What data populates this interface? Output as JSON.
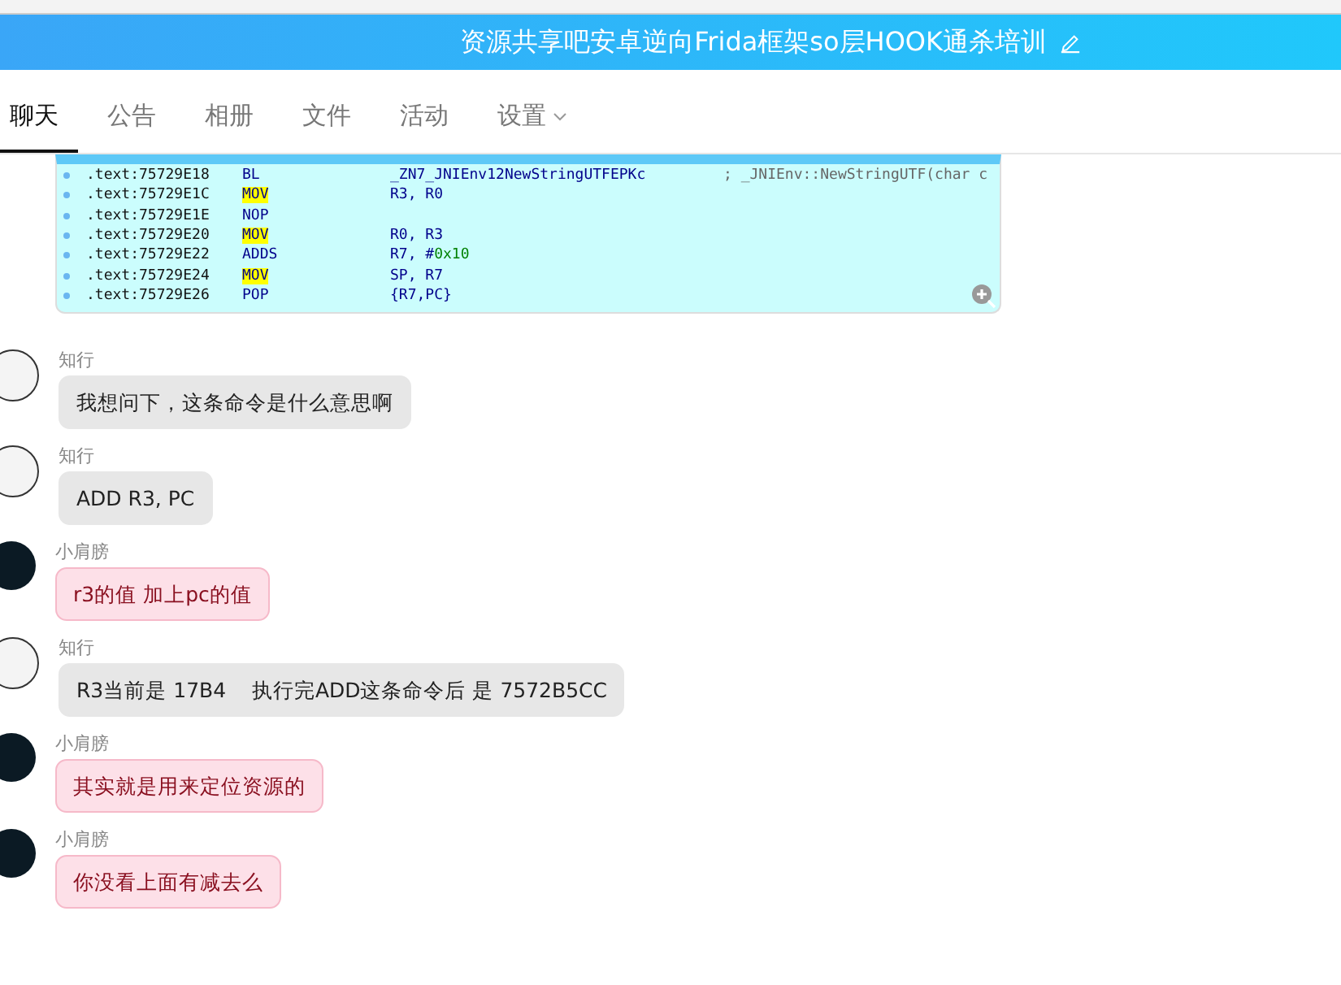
{
  "header": {
    "title": "资源共享吧安卓逆向Frida框架so层HOOK通杀培训"
  },
  "tabs": [
    {
      "label": "聊天",
      "selected": true,
      "dropdown": false
    },
    {
      "label": "公告",
      "selected": false,
      "dropdown": false
    },
    {
      "label": "相册",
      "selected": false,
      "dropdown": false
    },
    {
      "label": "文件",
      "selected": false,
      "dropdown": false
    },
    {
      "label": "活动",
      "selected": false,
      "dropdown": false
    },
    {
      "label": "设置",
      "selected": false,
      "dropdown": true
    }
  ],
  "code_image": {
    "lines": [
      {
        "address": ".text:75729E18",
        "op": "BL",
        "highlight": false,
        "args": "_ZN7_JNIEnv12NewStringUTFEPKc",
        "comment": "; _JNIEnv::NewStringUTF(char c"
      },
      {
        "address": ".text:75729E1C",
        "op": "MOV",
        "highlight": true,
        "args": "R3, R0"
      },
      {
        "address": ".text:75729E1E",
        "op": "NOP",
        "highlight": false
      },
      {
        "address": ".text:75729E20",
        "op": "MOV",
        "highlight": true,
        "args": "R0, R3"
      },
      {
        "address": ".text:75729E22",
        "op": "ADDS",
        "highlight": false,
        "args": "R7, #",
        "number": "0x10"
      },
      {
        "address": ".text:75729E24",
        "op": "MOV",
        "highlight": true,
        "args": "SP, R7"
      },
      {
        "address": ".text:75729E26",
        "op": "POP",
        "highlight": false,
        "args": "{R7,PC}"
      }
    ]
  },
  "messages": [
    {
      "sender": "知行",
      "kind": "plain",
      "text": "我想问下，这条命令是什么意思啊"
    },
    {
      "sender": "知行",
      "kind": "plain",
      "text": "ADD R3, PC"
    },
    {
      "sender": "小肩膀",
      "kind": "pink",
      "text": "r3的值 加上pc的值"
    },
    {
      "sender": "知行",
      "kind": "plain",
      "text": "R3当前是 17B4    执行完ADD这条命令后 是 7572B5CC"
    },
    {
      "sender": "小肩膀",
      "kind": "pink",
      "text": "其实就是用来定位资源的"
    },
    {
      "sender": "小肩膀",
      "kind": "pink",
      "text": "你没看上面有减去么"
    }
  ]
}
